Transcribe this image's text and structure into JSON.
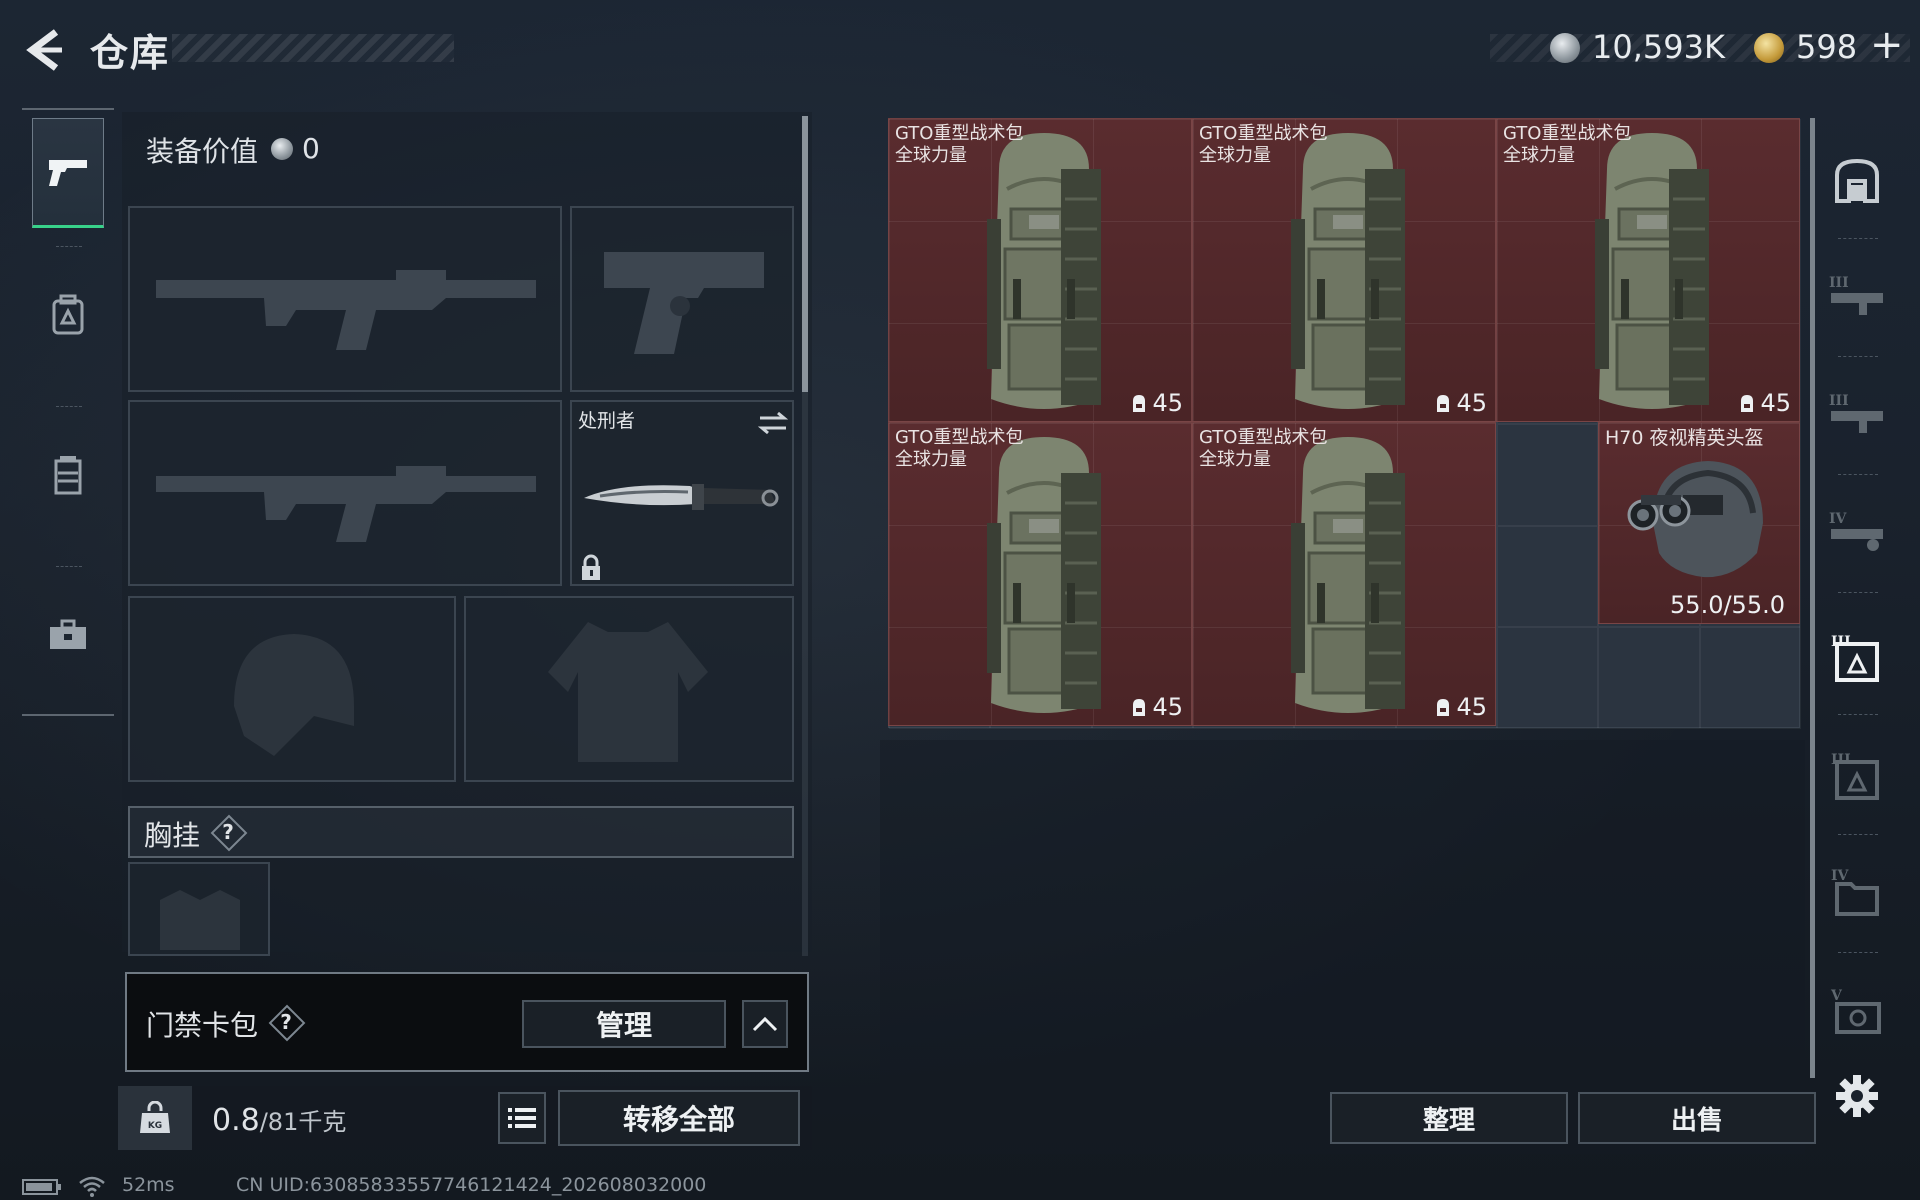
{
  "header": {
    "title": "仓库",
    "money": "10,593K",
    "gold": "598",
    "plus_label": "+"
  },
  "left_nav": {
    "items": [
      {
        "name": "weapons",
        "icon": "pistol-icon",
        "active": true
      },
      {
        "name": "backpack",
        "icon": "backpack-icon",
        "active": false
      },
      {
        "name": "armor",
        "icon": "vest-icon",
        "active": false
      },
      {
        "name": "supplies",
        "icon": "toolbox-icon",
        "active": false
      }
    ]
  },
  "equipment": {
    "value_label": "装备价值",
    "value": "0",
    "melee_name": "处刑者",
    "chest_label": "胸挂",
    "chest_help": "?",
    "card_pack_label": "门禁卡包",
    "card_pack_help": "?",
    "manage_button": "管理",
    "weight_current": "0.8",
    "weight_max": "/81千克",
    "transfer_all_button": "转移全部"
  },
  "storage": {
    "items": [
      {
        "name": "GTO重型战术包",
        "sub": "全球力量",
        "count": "45"
      },
      {
        "name": "GTO重型战术包",
        "sub": "全球力量",
        "count": "45"
      },
      {
        "name": "GTO重型战术包",
        "sub": "全球力量",
        "count": "45"
      },
      {
        "name": "GTO重型战术包",
        "sub": "全球力量",
        "count": "45"
      },
      {
        "name": "GTO重型战术包",
        "sub": "全球力量",
        "count": "45"
      }
    ],
    "helmet": {
      "name": "H70 夜视精英头盔",
      "durability": "55.0/55.0"
    },
    "sort_button": "整理",
    "sell_button": "出售"
  },
  "right_nav": {
    "items": [
      {
        "icon": "storage-home-icon"
      },
      {
        "icon": "weapon-rack-iii-icon",
        "level": "III"
      },
      {
        "icon": "weapon-rack-iii-b-icon",
        "level": "III"
      },
      {
        "icon": "weapon-rack-iv-icon",
        "level": "IV"
      },
      {
        "icon": "backpack-box-iii-icon",
        "level": "III",
        "active": true
      },
      {
        "icon": "backpack-box-iii-b-icon",
        "level": "III"
      },
      {
        "icon": "folder-box-iv-icon",
        "level": "IV"
      },
      {
        "icon": "safe-box-v-icon",
        "level": "V"
      }
    ]
  },
  "status_bar": {
    "latency": "52ms",
    "uid": "CN UID:6308583355774612142​4_202608032000"
  },
  "colors": {
    "accent_green": "#38d28a",
    "item_bg": "#5a2c2f"
  }
}
